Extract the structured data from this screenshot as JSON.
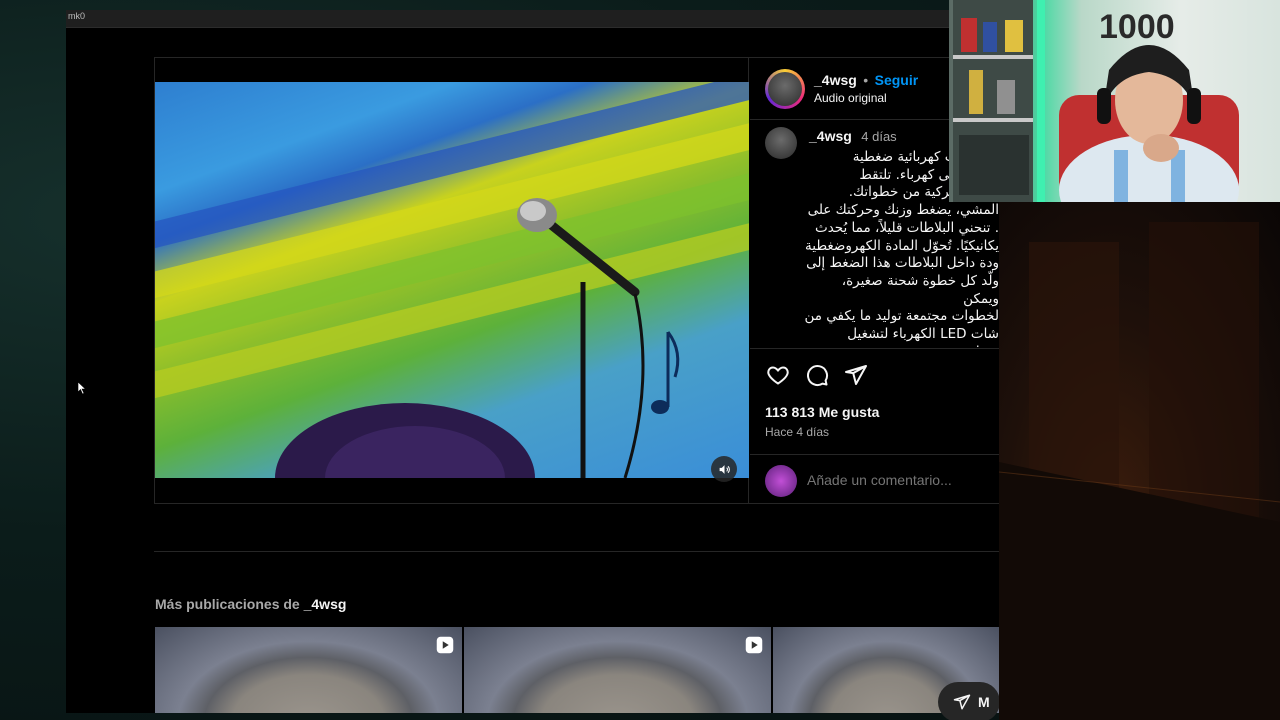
{
  "window": {
    "title": "mk0"
  },
  "post": {
    "username": "_4wsg",
    "separator": "•",
    "follow_label": "Seguir",
    "audio_label": "Audio original",
    "caption_author": "_4wsg",
    "caption_age": "4 días",
    "caption_text": "ي بلاطات كهربائية ضغطية\nالأقدام إلى كهرباء. تلتقط\nطاقة الحركية من خطواتك.\nالمشي، يضغط وزنك وحركتك على\n. تنحني البلاطات قليلاً، مما يُحدث\nيكانيكيًا. تُحوّل المادة الكهروضغطية\nودة داخل البلاطات هذا الضغط إلى\nولّد كل خطوة شحنة صغيرة، ويمكن\nلخطوات مجتمعة توليد ما يكفي من\nشات LED الكهرباء لتشغيل مصابيح\nقمية وأجهزة الاستشعار. في منطقة",
    "likes": "113 813 Me gusta",
    "posted_ago": "Hace 4 días",
    "comment_placeholder": "Añade un comentario..."
  },
  "more_posts": {
    "prefix": "Más publicaciones de ",
    "username": "_4wsg",
    "thumbnail_count": 3
  },
  "fab": {
    "label": "M"
  },
  "icons": {
    "like": "heart-icon",
    "comment": "comment-icon",
    "share": "send-icon",
    "mute": "speaker-icon",
    "reel": "reel-play-icon"
  },
  "colors": {
    "accent": "#0095f6",
    "background": "#000000",
    "text": "#f5f5f5",
    "muted": "#a8a8a8",
    "border": "#262626"
  }
}
